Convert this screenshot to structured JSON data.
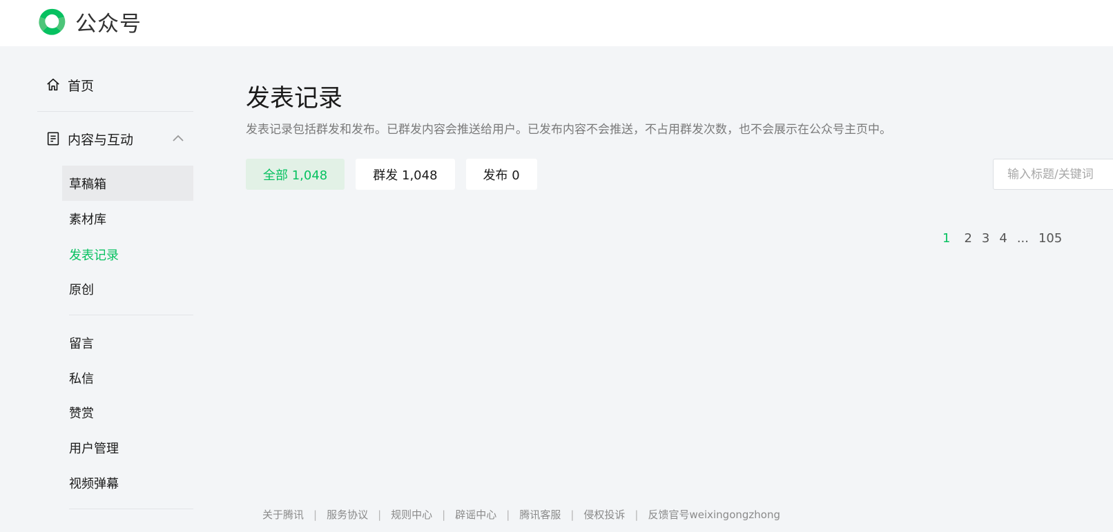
{
  "header": {
    "brand": "公众号",
    "logo_icon": "wechat-official-logo-icon"
  },
  "sidebar": {
    "home": {
      "label": "首页",
      "icon": "home-icon"
    },
    "content_group": {
      "label": "内容与互动",
      "icon": "document-icon",
      "expanded": true,
      "items": [
        {
          "label": "草稿箱"
        },
        {
          "label": "素材库"
        },
        {
          "label": "发表记录"
        },
        {
          "label": "原创"
        },
        {
          "label": "留言"
        },
        {
          "label": "私信"
        },
        {
          "label": "赞赏"
        },
        {
          "label": "用户管理"
        },
        {
          "label": "视频弹幕"
        }
      ]
    }
  },
  "main": {
    "title": "发表记录",
    "description": "发表记录包括群发和发布。已群发内容会推送给用户。已发布内容不会推送，不占用群发次数，也不会展示在公众号主页中。",
    "tabs": [
      {
        "label": "全部 1,048"
      },
      {
        "label": "群发 1,048"
      },
      {
        "label": "发布 0"
      }
    ],
    "search": {
      "placeholder": "输入标题/关键词",
      "value": ""
    },
    "pagination": {
      "pages": [
        "1",
        "2",
        "3",
        "4"
      ],
      "ellipsis": "...",
      "last": "105",
      "current": "1"
    }
  },
  "footer": {
    "links": [
      "关于腾讯",
      "服务协议",
      "规则中心",
      "辟谣中心",
      "腾讯客服",
      "侵权投诉",
      "反馈官号weixingongzhong"
    ],
    "separator": "|"
  },
  "colors": {
    "accent": "#07c160",
    "background": "#f3f5f7",
    "tab_selected_bg": "#e2f1e6"
  }
}
